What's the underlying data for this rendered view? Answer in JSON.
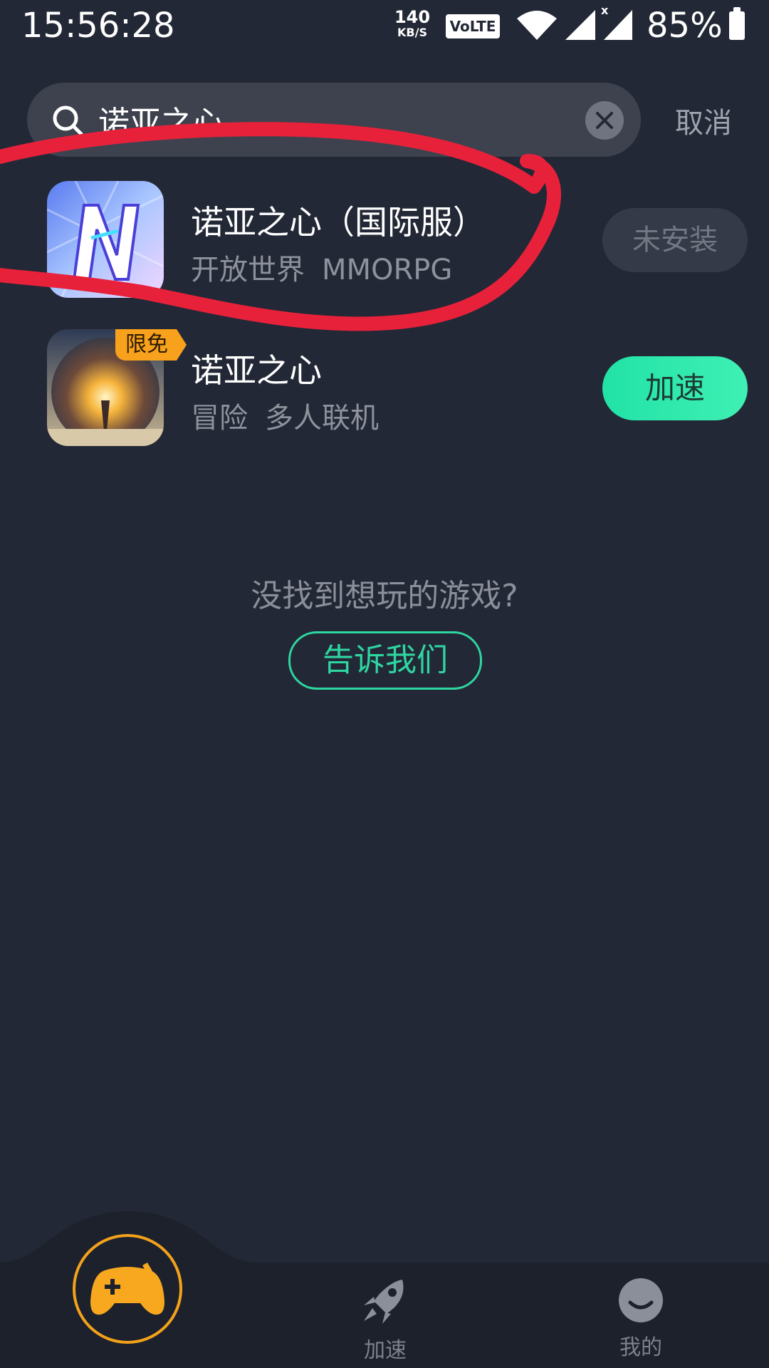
{
  "status_bar": {
    "time": "15:56:28",
    "net_speed_value": "140",
    "net_speed_unit": "KB/S",
    "volte": "VoLTE",
    "battery_percent": "85%"
  },
  "search": {
    "query": "诺亚之心",
    "cancel_label": "取消"
  },
  "results": [
    {
      "title": "诺亚之心（国际服）",
      "tags": [
        "开放世界",
        "MMORPG"
      ],
      "action_label": "未安装",
      "action_state": "disabled",
      "icon": "noah-n-logo-icon"
    },
    {
      "title": "诺亚之心",
      "tags": [
        "冒险",
        "多人联机"
      ],
      "badge": "限免",
      "action_label": "加速",
      "action_state": "primary",
      "icon": "noah-explosion-art-icon"
    }
  ],
  "empty_prompt": {
    "text": "没找到想玩的游戏?",
    "button_label": "告诉我们"
  },
  "bottom_nav": {
    "items": [
      {
        "label": "",
        "icon": "gamepad-add-icon",
        "active": true
      },
      {
        "label": "加速",
        "icon": "rocket-icon"
      },
      {
        "label": "我的",
        "icon": "smiley-face-icon"
      }
    ]
  },
  "colors": {
    "background": "#232836",
    "accent": "#2ed6a0",
    "home_accent": "#f2a21b",
    "annotation": "#e8213b"
  }
}
